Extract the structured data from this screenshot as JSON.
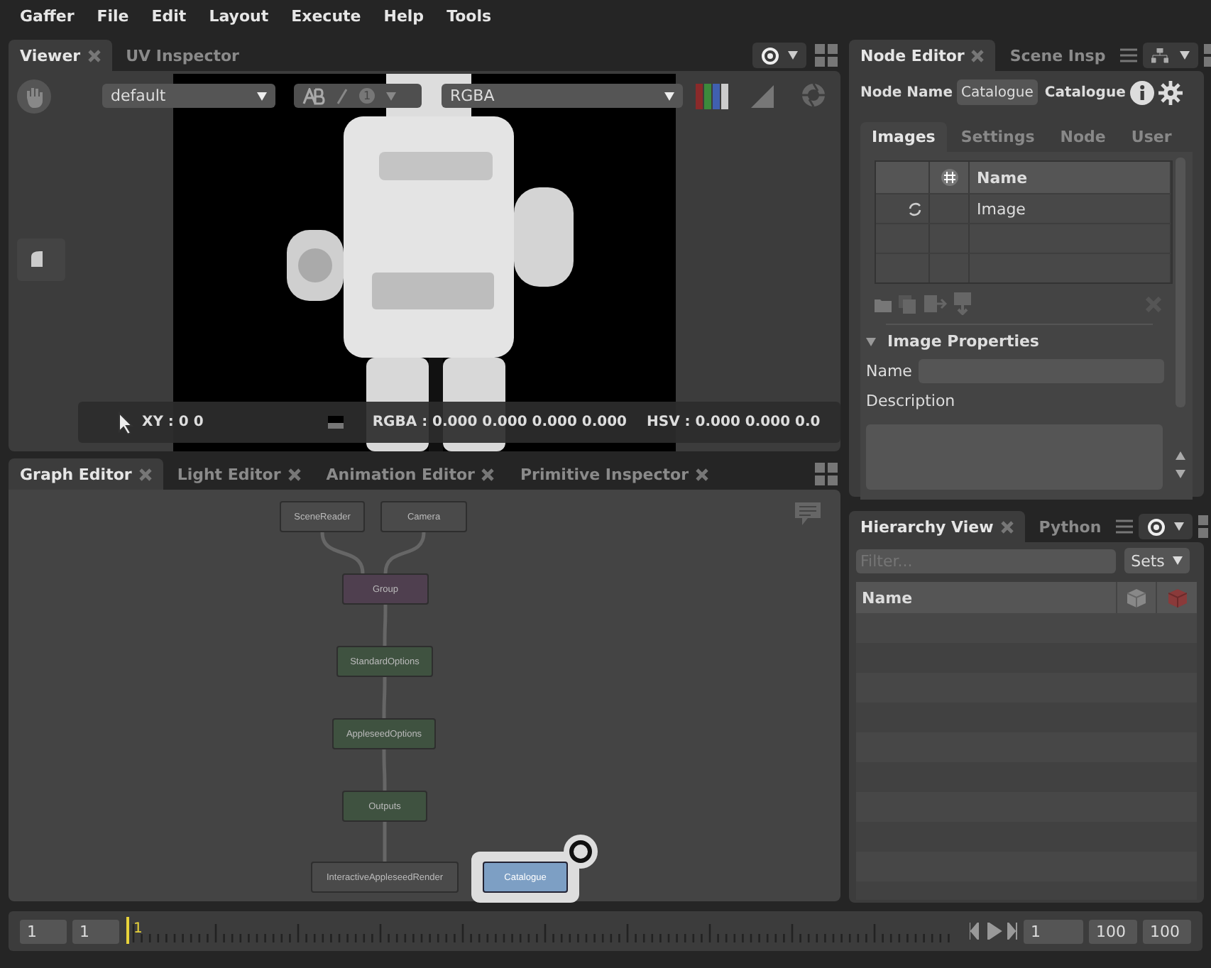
{
  "menu": [
    "Gaffer",
    "File",
    "Edit",
    "Layout",
    "Execute",
    "Help",
    "Tools"
  ],
  "viewer": {
    "tabs": [
      {
        "label": "Viewer",
        "selected": true
      },
      {
        "label": "UV Inspector",
        "selected": false
      }
    ],
    "display_transform": "default",
    "compare_index": "1",
    "channels": "RGBA",
    "status": {
      "xy": "XY : 0 0",
      "rgba": "RGBA : 0.000 0.000 0.000 0.000",
      "hsv": "HSV : 0.000 0.000 0.0"
    }
  },
  "graph_editor": {
    "tabs": [
      {
        "label": "Graph Editor",
        "selected": true
      },
      {
        "label": "Light Editor",
        "selected": false
      },
      {
        "label": "Animation Editor",
        "selected": false
      },
      {
        "label": "Primitive Inspector",
        "selected": false
      }
    ],
    "nodes": [
      {
        "label": "SceneReader",
        "kind": "plain",
        "selected": false
      },
      {
        "label": "Camera",
        "kind": "plain",
        "selected": false
      },
      {
        "label": "Group",
        "kind": "group",
        "selected": false
      },
      {
        "label": "StandardOptions",
        "kind": "options",
        "selected": false
      },
      {
        "label": "AppleseedOptions",
        "kind": "options",
        "selected": false
      },
      {
        "label": "Outputs",
        "kind": "options",
        "selected": false
      },
      {
        "label": "InteractiveAppleseedRender",
        "kind": "plain",
        "selected": false
      },
      {
        "label": "Catalogue",
        "selected": true
      }
    ]
  },
  "node_editor": {
    "tabs": [
      {
        "label": "Node Editor",
        "selected": true
      },
      {
        "label": "Scene Insp",
        "selected": false
      }
    ],
    "node_name_label": "Node Name",
    "node_name": "Catalogue",
    "node_type": "Catalogue",
    "sub_tabs": [
      {
        "label": "Images",
        "selected": true
      },
      {
        "label": "Settings",
        "selected": false
      },
      {
        "label": "Node",
        "selected": false
      },
      {
        "label": "User",
        "selected": false
      }
    ],
    "images_table": {
      "name_column": "Name",
      "rows": [
        {
          "name": "Image"
        }
      ]
    },
    "image_properties": {
      "title": "Image Properties",
      "expanded": true,
      "name_label": "Name",
      "description_label": "Description"
    }
  },
  "hierarchy": {
    "tabs": [
      {
        "label": "Hierarchy View",
        "selected": true
      },
      {
        "label": "Python",
        "selected": false
      }
    ],
    "filter_placeholder": "Filter...",
    "sets_button": "Sets",
    "name_column": "Name"
  },
  "timeline": {
    "start_outer": "1",
    "start_inner": "1",
    "current_marker": "1",
    "current_frame": "1",
    "end_inner": "100",
    "end_outer": "100"
  }
}
